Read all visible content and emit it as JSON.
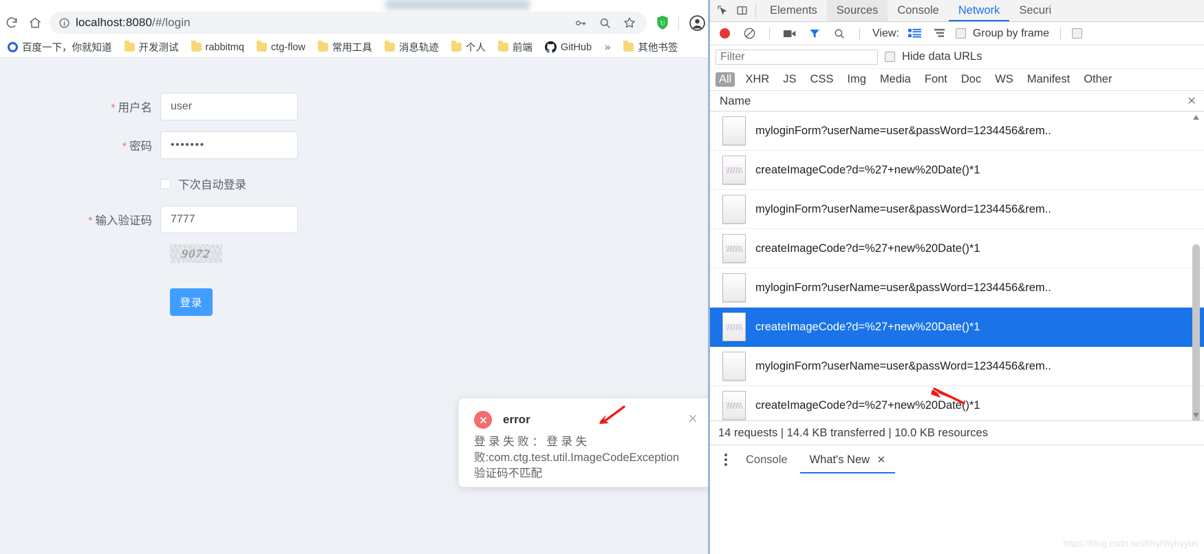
{
  "browser": {
    "nav": {
      "reload_icon": "reload-icon",
      "home_icon": "home-icon"
    },
    "omnibox": {
      "info_icon": "page-info-icon",
      "url_host": "localhost:8080",
      "url_path": "/#/login",
      "key_icon": "password-key-icon",
      "zoom_icon": "zoom-magnifier-icon",
      "star_icon": "bookmark-star-icon"
    },
    "extensions": {
      "shield_icon": "adblock-shield-icon",
      "profile_icon": "profile-avatar-icon"
    },
    "bookmarks": [
      {
        "label": "百度一下，你就知道",
        "icon": "baidu-icon"
      },
      {
        "label": "开发测试",
        "icon": "folder-icon"
      },
      {
        "label": "rabbitmq",
        "icon": "folder-icon"
      },
      {
        "label": "ctg-flow",
        "icon": "folder-icon"
      },
      {
        "label": "常用工具",
        "icon": "folder-icon"
      },
      {
        "label": "消息轨迹",
        "icon": "folder-icon"
      },
      {
        "label": "个人",
        "icon": "folder-icon"
      },
      {
        "label": "前端",
        "icon": "folder-icon"
      },
      {
        "label": "GitHub",
        "icon": "github-icon"
      }
    ],
    "bookmarks_overflow": "»",
    "other_bookmarks": {
      "label": "其他书签",
      "icon": "folder-icon"
    }
  },
  "login": {
    "username": {
      "label": "用户名",
      "required_mark": "*",
      "value": "user"
    },
    "password": {
      "label": "密码",
      "required_mark": "*",
      "value": "•••••••"
    },
    "remember": {
      "label": "下次自动登录",
      "checked": false
    },
    "captcha_input": {
      "label": "输入验证码",
      "required_mark": "*",
      "value": "7777"
    },
    "captcha_image_text": "9072",
    "submit_label": "登录"
  },
  "notification": {
    "title": "error",
    "icon": "error-circle-icon",
    "close_icon": "close-icon",
    "line1": "登 录 失 败 ： 登 录 失",
    "line2": "败:com.ctg.test.util.ImageCodeException",
    "line3": "验证码不匹配"
  },
  "devtools": {
    "inspect_icon": "inspect-cursor-icon",
    "device_icon": "device-toolbar-icon",
    "tabs": [
      {
        "label": "Elements",
        "active": false
      },
      {
        "label": "Sources",
        "active": false
      },
      {
        "label": "Console",
        "active": false
      },
      {
        "label": "Network",
        "active": true
      },
      {
        "label": "Securi",
        "active": false
      }
    ],
    "toolbar": {
      "record_icon": "record-button-icon",
      "clear_icon": "clear-icon",
      "camera_icon": "capture-screenshots-icon",
      "filter_icon": "filter-funnel-icon",
      "search_icon": "search-icon",
      "view_label": "View:",
      "view_list_icon": "view-list-icon",
      "view_waterfall_icon": "view-waterfall-icon",
      "group_by_frame_label": "Group by frame",
      "group_by_frame_checked": false
    },
    "filter": {
      "placeholder": "Filter",
      "value": "",
      "hide_data_urls_label": "Hide data URLs",
      "hide_data_urls_checked": false
    },
    "types": [
      "All",
      "XHR",
      "JS",
      "CSS",
      "Img",
      "Media",
      "Font",
      "Doc",
      "WS",
      "Manifest",
      "Other"
    ],
    "selected_type": "All",
    "column_header": "Name",
    "column_close_icon": "close-icon",
    "requests": [
      {
        "name": "myloginForm?userName=user&passWord=1234456&rem..",
        "thumb": "blank",
        "selected": false
      },
      {
        "name": "createImageCode?d=%27+new%20Date()*1",
        "thumb": "captcha",
        "selected": false
      },
      {
        "name": "myloginForm?userName=user&passWord=1234456&rem..",
        "thumb": "blank",
        "selected": false
      },
      {
        "name": "createImageCode?d=%27+new%20Date()*1",
        "thumb": "captcha",
        "selected": false
      },
      {
        "name": "myloginForm?userName=user&passWord=1234456&rem..",
        "thumb": "blank",
        "selected": false
      },
      {
        "name": "createImageCode?d=%27+new%20Date()*1",
        "thumb": "captcha",
        "selected": true
      },
      {
        "name": "myloginForm?userName=user&passWord=1234456&rem..",
        "thumb": "blank",
        "selected": false
      },
      {
        "name": "createImageCode?d=%27+new%20Date()*1",
        "thumb": "captcha",
        "selected": false
      }
    ],
    "status_bar": "14 requests  |  14.4 KB transferred  |  10.0 KB resources",
    "drawer": {
      "menu_icon": "more-options-icon",
      "tabs": [
        {
          "label": "Console",
          "active": false
        },
        {
          "label": "What's New",
          "active": true
        }
      ],
      "close_icon": "close-icon"
    },
    "watermark": "https://blog.csdn.net/hhyhhyhyyun"
  }
}
